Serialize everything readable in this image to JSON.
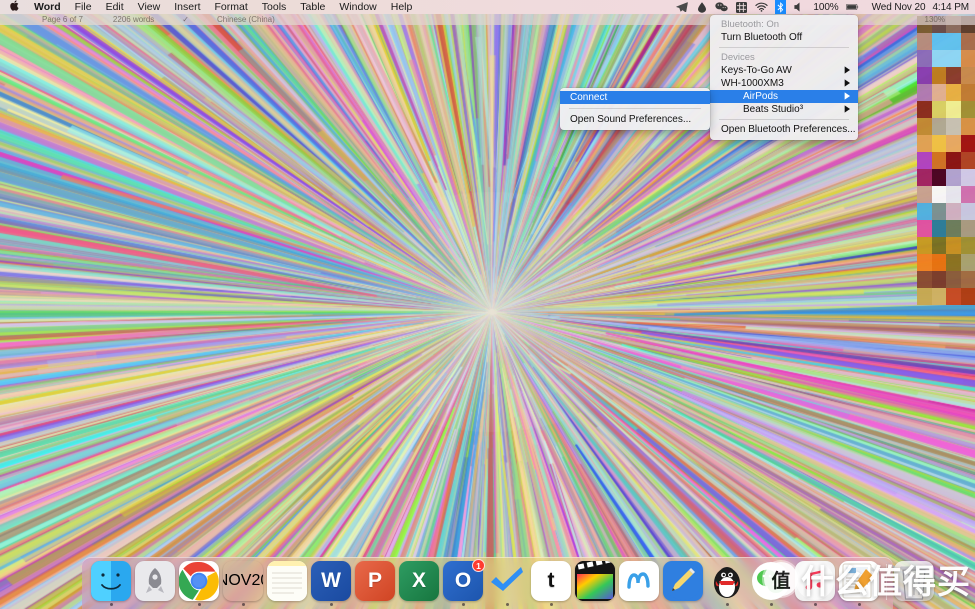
{
  "menubar": {
    "apple_icon": "apple-logo-icon",
    "app_menus": [
      "Word",
      "File",
      "Edit",
      "View",
      "Insert",
      "Format",
      "Tools",
      "Table",
      "Window",
      "Help"
    ],
    "status_icons": [
      "telegram-icon",
      "droplet-icon",
      "wechat-icon",
      "input-source-grid-icon",
      "wifi-icon",
      "bluetooth-icon",
      "volume-icon"
    ],
    "battery_percent": "100%",
    "battery_icon": "battery-full-icon",
    "date": "Wed Nov 20",
    "time": "4:14 PM"
  },
  "word_status_bar": {
    "page": "Page 6 of 7",
    "words": "2206 words",
    "spell": "✓",
    "language": "Chinese (China)",
    "zoom": "130%"
  },
  "bluetooth_menu": {
    "status_label": "Bluetooth: On",
    "toggle_label": "Turn Bluetooth Off",
    "devices_header": "Devices",
    "devices": [
      {
        "name": "Keys-To-Go AW",
        "selected": false,
        "indent": false
      },
      {
        "name": "WH-1000XM3",
        "selected": false,
        "indent": false
      },
      {
        "name": "AirPods",
        "selected": true,
        "indent": true
      },
      {
        "name": "Beats Studio³",
        "selected": false,
        "indent": true
      }
    ],
    "submenu_arrow": "▶",
    "preferences_label": "Open Bluetooth Preferences..."
  },
  "bluetooth_submenu": {
    "items": [
      {
        "label": "Connect",
        "selected": true
      },
      {
        "label": "Open Sound Preferences...",
        "selected": false
      }
    ]
  },
  "dock": {
    "items": [
      {
        "name": "finder",
        "label": "Finder",
        "running": true,
        "badge": ""
      },
      {
        "name": "launchpad",
        "label": "Launchpad",
        "running": false,
        "badge": ""
      },
      {
        "name": "chrome",
        "label": "Google Chrome",
        "running": true,
        "badge": ""
      },
      {
        "name": "calendar",
        "label": "Calendar",
        "running": true,
        "badge": "",
        "month": "NOV",
        "day": "20"
      },
      {
        "name": "notes",
        "label": "Notes",
        "running": false,
        "badge": ""
      },
      {
        "name": "word",
        "label": "Microsoft Word",
        "running": true,
        "badge": "",
        "letter": "W"
      },
      {
        "name": "powerpoint",
        "label": "PowerPoint",
        "running": false,
        "badge": "",
        "letter": "P"
      },
      {
        "name": "excel",
        "label": "Microsoft Excel",
        "running": false,
        "badge": "",
        "letter": "X"
      },
      {
        "name": "outlook",
        "label": "Outlook",
        "running": true,
        "badge": "1",
        "letter": "O"
      },
      {
        "name": "things",
        "label": "Things",
        "running": true,
        "badge": ""
      },
      {
        "name": "tot",
        "label": "Tot",
        "running": true,
        "badge": "",
        "letter": "t"
      },
      {
        "name": "finalcut",
        "label": "Final Cut Pro",
        "running": false,
        "badge": ""
      },
      {
        "name": "mweb",
        "label": "MWeb",
        "running": false,
        "badge": ""
      },
      {
        "name": "notability",
        "label": "Notability",
        "running": false,
        "badge": ""
      },
      {
        "name": "qq",
        "label": "QQ",
        "running": true,
        "badge": ""
      },
      {
        "name": "wechat",
        "label": "WeChat",
        "running": true,
        "badge": ""
      },
      {
        "name": "music",
        "label": "Music",
        "running": true,
        "badge": ""
      },
      {
        "name": "pages",
        "label": "Pages",
        "running": true,
        "badge": ""
      },
      {
        "name": "trash",
        "label": "Trash",
        "running": false,
        "badge": ""
      }
    ]
  },
  "watermark": {
    "badge": "值",
    "text": "什么值得买"
  },
  "colors": {
    "accent_blue": "#2a7fe8",
    "menubar_bg": "#eeddde",
    "menu_bg": "#eeedf0",
    "badge_red": "#ff3b30"
  },
  "palette_strip": {
    "rows": [
      [
        "#7a5a2e",
        "#6b4a46",
        "#8c6a5a",
        "#5a3a2a"
      ],
      [
        "#b88b7a",
        "#5ec0f0",
        "#5ec0f0",
        "#a86a4a"
      ],
      [
        "#8a6ab8",
        "#8ed4f5",
        "#8ed4f5",
        "#d88a4a"
      ],
      [
        "#8a3ab0",
        "#c07a20",
        "#8a3a2a",
        "#c88a4a"
      ],
      [
        "#b07ab0",
        "#e0b090",
        "#e8b040",
        "#c07a30"
      ],
      [
        "#8a2a1a",
        "#d8d060",
        "#f0f090",
        "#a09030"
      ],
      [
        "#c08a30",
        "#b0a890",
        "#c8c0b0",
        "#d89040"
      ],
      [
        "#e0a050",
        "#f0c040",
        "#e8a860",
        "#a01010"
      ],
      [
        "#b040c0",
        "#d07020",
        "#8a1010",
        "#b04020"
      ],
      [
        "#a02060",
        "#4a0020",
        "#b0a0d0",
        "#d0c8e8"
      ],
      [
        "#c8a090",
        "#f8f8f8",
        "#e8e8f0",
        "#d070b0"
      ],
      [
        "#50b0e0",
        "#7a9090",
        "#d0b0c0",
        "#c8c8e0"
      ],
      [
        "#e050a0",
        "#2a7a98",
        "#6a7a5a",
        "#a89880"
      ],
      [
        "#c89820",
        "#7a7020",
        "#c89020",
        "#a09030"
      ],
      [
        "#f08020",
        "#e87010",
        "#8a7020",
        "#a8a070"
      ],
      [
        "#8a4a30",
        "#7a3a2a",
        "#8a5a3a",
        "#a06a40"
      ],
      [
        "#c8a850",
        "#d0b060",
        "#c84820",
        "#b03a10"
      ]
    ]
  }
}
